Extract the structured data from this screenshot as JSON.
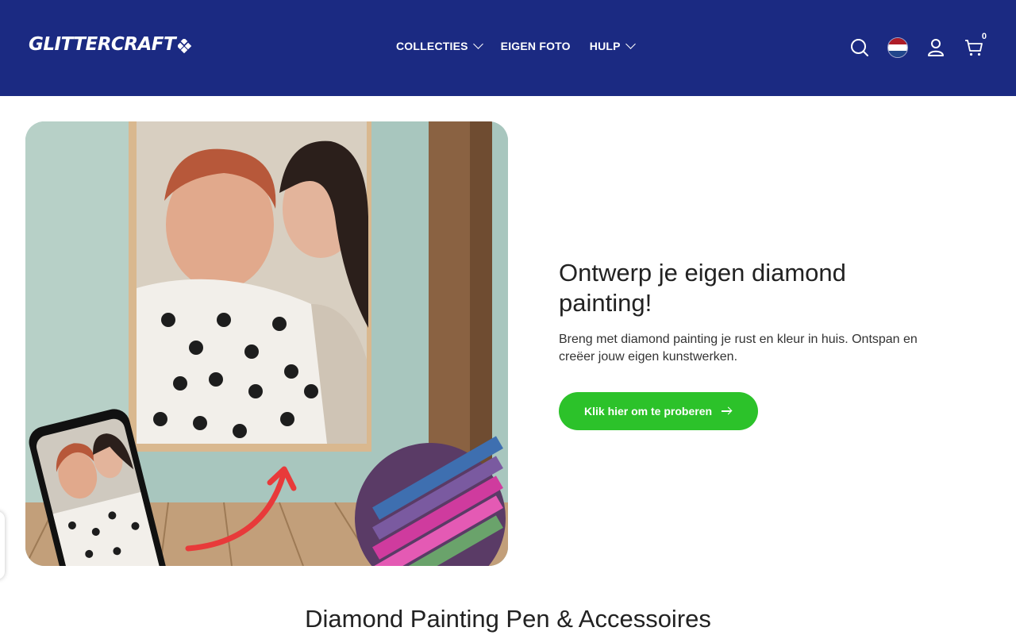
{
  "header": {
    "logo_text": "GLITTERCRAFT",
    "nav": [
      {
        "label": "COLLECTIES",
        "has_dropdown": true
      },
      {
        "label": "EIGEN FOTO",
        "has_dropdown": false
      },
      {
        "label": "HULP",
        "has_dropdown": true
      }
    ],
    "icons": [
      "search-icon",
      "language-flag-nl",
      "account-icon",
      "cart-icon"
    ],
    "cart_count": "0",
    "colors": {
      "header_bg": "#1b2a82",
      "text": "#ffffff"
    }
  },
  "hero": {
    "title": "Ontwerp je eigen diamond painting!",
    "subtitle": "Breng met diamond painting je rust en kleur in huis. Ontspan en creëer jouw eigen kunstwerken.",
    "cta_label": "Klik hier om te proberen",
    "cta_color": "#2cc22a",
    "image_alt": "Diamond painting of a woman and her daughter on a wall, phone preview and diamond close-up"
  },
  "section": {
    "title": "Diamond Painting Pen & Accessoires"
  }
}
